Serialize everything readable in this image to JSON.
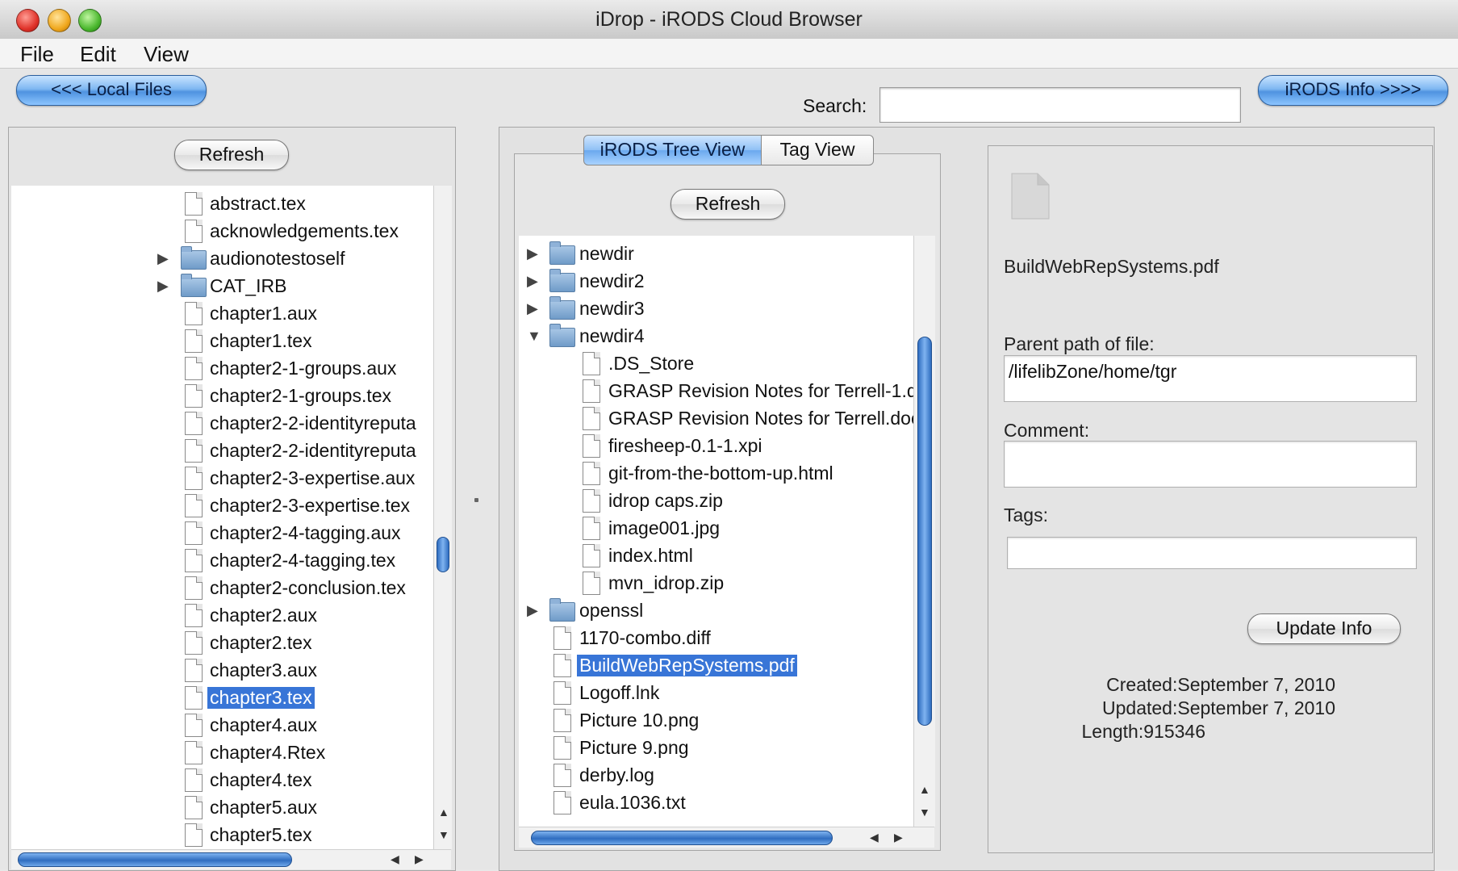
{
  "window": {
    "title": "iDrop - iRODS Cloud Browser"
  },
  "menu": {
    "file": "File",
    "edit": "Edit",
    "view": "View"
  },
  "toolbar": {
    "local_files": "<<< Local Files",
    "search_label": "Search:",
    "search_value": "",
    "irods_info": "iRODS Info >>>>"
  },
  "local": {
    "refresh": "Refresh",
    "items": [
      {
        "name": "abstract.tex",
        "type": "file"
      },
      {
        "name": "acknowledgements.tex",
        "type": "file"
      },
      {
        "name": "audionotestoself",
        "type": "folder"
      },
      {
        "name": "CAT_IRB",
        "type": "folder"
      },
      {
        "name": "chapter1.aux",
        "type": "file"
      },
      {
        "name": "chapter1.tex",
        "type": "file"
      },
      {
        "name": "chapter2-1-groups.aux",
        "type": "file"
      },
      {
        "name": "chapter2-1-groups.tex",
        "type": "file"
      },
      {
        "name": "chapter2-2-identityreputa",
        "type": "file"
      },
      {
        "name": "chapter2-2-identityreputa",
        "type": "file"
      },
      {
        "name": "chapter2-3-expertise.aux",
        "type": "file"
      },
      {
        "name": "chapter2-3-expertise.tex",
        "type": "file"
      },
      {
        "name": "chapter2-4-tagging.aux",
        "type": "file"
      },
      {
        "name": "chapter2-4-tagging.tex",
        "type": "file"
      },
      {
        "name": "chapter2-conclusion.tex",
        "type": "file"
      },
      {
        "name": "chapter2.aux",
        "type": "file"
      },
      {
        "name": "chapter2.tex",
        "type": "file"
      },
      {
        "name": "chapter3.aux",
        "type": "file"
      },
      {
        "name": "chapter3.tex",
        "type": "file",
        "selected": true
      },
      {
        "name": "chapter4.aux",
        "type": "file"
      },
      {
        "name": "chapter4.Rtex",
        "type": "file"
      },
      {
        "name": "chapter4.tex",
        "type": "file"
      },
      {
        "name": "chapter5.aux",
        "type": "file"
      },
      {
        "name": "chapter5.tex",
        "type": "file"
      }
    ]
  },
  "irods": {
    "tabs": [
      "iRODS Tree View",
      "Tag View"
    ],
    "refresh": "Refresh",
    "items": [
      {
        "name": "newdir",
        "type": "folder",
        "expanded": false,
        "level": 0
      },
      {
        "name": "newdir2",
        "type": "folder",
        "expanded": false,
        "level": 0
      },
      {
        "name": "newdir3",
        "type": "folder",
        "expanded": false,
        "level": 0
      },
      {
        "name": "newdir4",
        "type": "folder",
        "expanded": true,
        "level": 0
      },
      {
        "name": ".DS_Store",
        "type": "file",
        "level": 1
      },
      {
        "name": "GRASP Revision Notes for Terrell-1.d",
        "type": "file",
        "level": 1
      },
      {
        "name": "GRASP Revision Notes for Terrell.doc",
        "type": "file",
        "level": 1
      },
      {
        "name": "firesheep-0.1-1.xpi",
        "type": "file",
        "level": 1
      },
      {
        "name": "git-from-the-bottom-up.html",
        "type": "file",
        "level": 1
      },
      {
        "name": "idrop caps.zip",
        "type": "file",
        "level": 1
      },
      {
        "name": "image001.jpg",
        "type": "file",
        "level": 1
      },
      {
        "name": "index.html",
        "type": "file",
        "level": 1
      },
      {
        "name": "mvn_idrop.zip",
        "type": "file",
        "level": 1
      },
      {
        "name": "openssl",
        "type": "folder",
        "expanded": false,
        "level": 0
      },
      {
        "name": "1170-combo.diff",
        "type": "file",
        "level": 0
      },
      {
        "name": "BuildWebRepSystems.pdf",
        "type": "file",
        "level": 0,
        "selected": true
      },
      {
        "name": "Logoff.lnk",
        "type": "file",
        "level": 0
      },
      {
        "name": "Picture 10.png",
        "type": "file",
        "level": 0
      },
      {
        "name": "Picture 9.png",
        "type": "file",
        "level": 0
      },
      {
        "name": "derby.log",
        "type": "file",
        "level": 0
      },
      {
        "name": "eula.1036.txt",
        "type": "file",
        "level": 0
      }
    ]
  },
  "info": {
    "file_name": "BuildWebRepSystems.pdf",
    "parent_label": "Parent path of file:",
    "parent_value": "/lifelibZone/home/tgr",
    "comment_label": "Comment:",
    "comment_value": "",
    "tags_label": "Tags:",
    "tags_value": "",
    "update_button": "Update Info",
    "created": "Created:September 7, 2010",
    "updated": "Updated:September 7, 2010",
    "length": "Length:915346"
  }
}
